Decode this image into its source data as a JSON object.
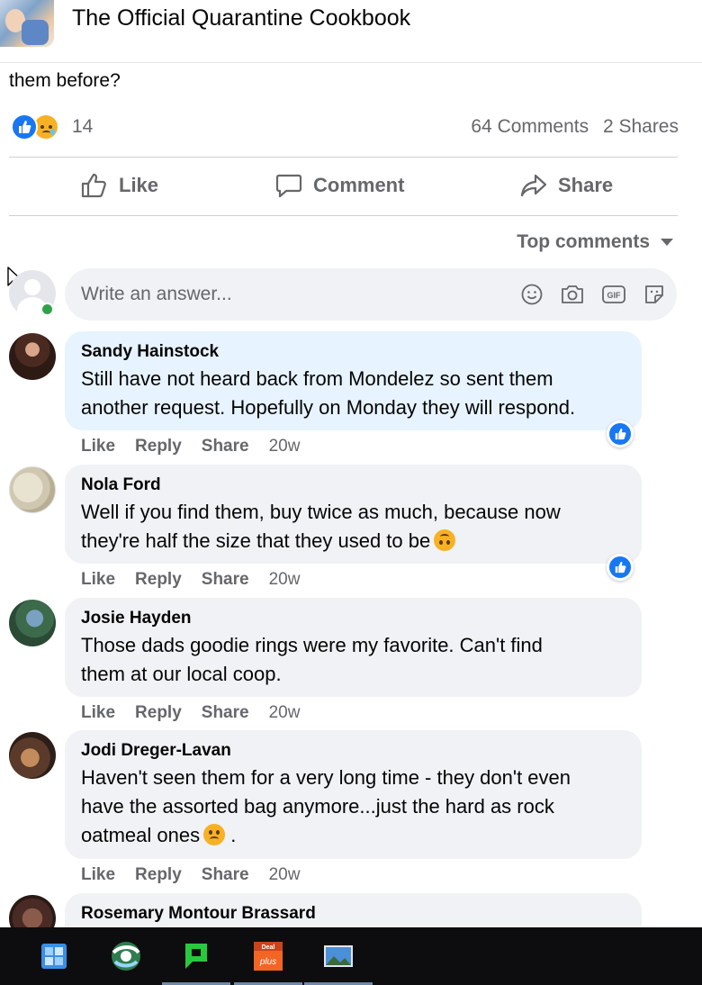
{
  "header": {
    "group_title": "The Official Quarantine Cookbook"
  },
  "post": {
    "text_tail": "them before?",
    "reaction_count": "14",
    "comments_count": "64 Comments",
    "shares_count": "2 Shares",
    "actions": {
      "like": "Like",
      "comment": "Comment",
      "share": "Share"
    },
    "sort_label": "Top comments"
  },
  "composer": {
    "placeholder": "Write an answer..."
  },
  "comments": [
    {
      "name": "Sandy Hainstock",
      "line1": "Still have not heard back from Mondelez so sent them",
      "line2": "another request. Hopefully on Monday they will respond.",
      "like": "Like",
      "reply": "Reply",
      "share": "Share",
      "time": "20w"
    },
    {
      "name": "Nola Ford",
      "line1": "Well if you find them, buy twice as much, because now",
      "line2": "they're half the size that they used to be",
      "like": "Like",
      "reply": "Reply",
      "share": "Share",
      "time": "20w"
    },
    {
      "name": "Josie Hayden",
      "line1": "Those dads goodie rings were my favorite. Can't find",
      "line2": "them at our local coop.",
      "like": "Like",
      "reply": "Reply",
      "share": "Share",
      "time": "20w"
    },
    {
      "name": "Jodi Dreger-Lavan",
      "line1": "Haven't seen them for a very long time - they don't even",
      "line2": "have the assorted bag anymore...just the hard as rock",
      "line3": "oatmeal ones",
      "line3_tail": " .",
      "like": "Like",
      "reply": "Reply",
      "share": "Share",
      "time": "20w"
    },
    {
      "name": "Rosemary Montour Brassard"
    }
  ],
  "colors": {
    "facebook_blue": "#1877f2",
    "highlight_bubble": "#e7f3ff",
    "bubble": "#f0f2f5",
    "secondary_text": "#65676b",
    "online_green": "#31a24c"
  },
  "taskbar": {
    "icons": [
      "windows-store-icon",
      "browser-globe-icon",
      "green-chat-icon",
      "deal-plus-icon",
      "landscape-photo-icon"
    ]
  }
}
